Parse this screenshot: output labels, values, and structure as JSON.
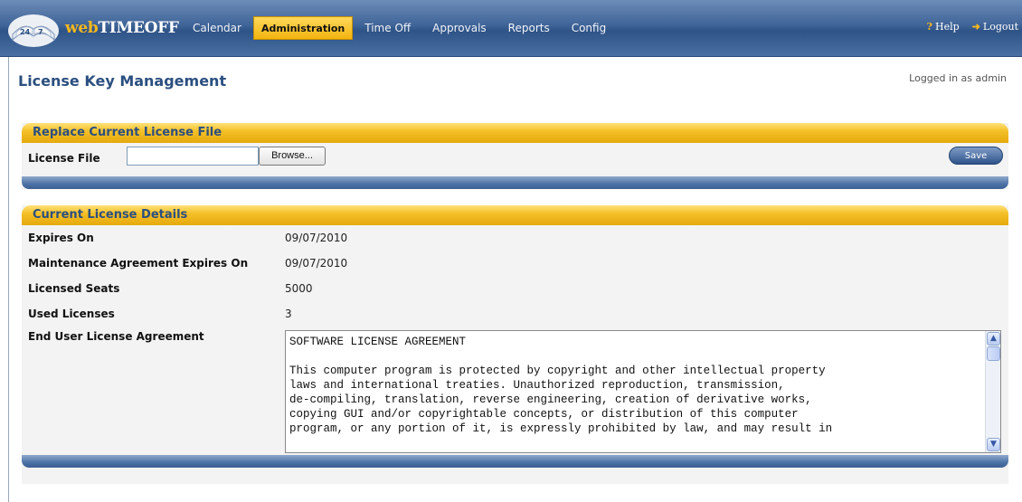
{
  "app": {
    "logo_web": "web",
    "logo_time": "TIMEOFF"
  },
  "nav": {
    "items": [
      {
        "label": "Calendar",
        "active": false
      },
      {
        "label": "Administration",
        "active": true
      },
      {
        "label": "Time Off",
        "active": false
      },
      {
        "label": "Approvals",
        "active": false
      },
      {
        "label": "Reports",
        "active": false
      },
      {
        "label": "Config",
        "active": false
      }
    ],
    "help_label": "Help",
    "logout_label": "Logout"
  },
  "page": {
    "title": "License Key Management",
    "logged_in": "Logged in as admin"
  },
  "replace_panel": {
    "title": "Replace Current License File",
    "file_label": "License File",
    "file_value": "",
    "browse_label": "Browse...",
    "save_label": "Save"
  },
  "details_panel": {
    "title": "Current License Details",
    "rows": [
      {
        "label": "Expires On",
        "value": "09/07/2010"
      },
      {
        "label": "Maintenance Agreement Expires On",
        "value": "09/07/2010"
      },
      {
        "label": "Licensed Seats",
        "value": "5000"
      },
      {
        "label": "Used Licenses",
        "value": "3"
      }
    ],
    "eula_label": "End User License Agreement",
    "eula_text": "SOFTWARE LICENSE AGREEMENT\n\nThis computer program is protected by copyright and other intellectual property\nlaws and international treaties. Unauthorized reproduction, transmission,\nde-compiling, translation, reverse engineering, creation of derivative works,\ncopying GUI and/or copyrightable concepts, or distribution of this computer\nprogram, or any portion of it, is expressly prohibited by law, and may result in"
  },
  "colors": {
    "nav_blue": "#3f6498",
    "accent_gold": "#f4c028",
    "title_blue": "#2b4f80"
  }
}
